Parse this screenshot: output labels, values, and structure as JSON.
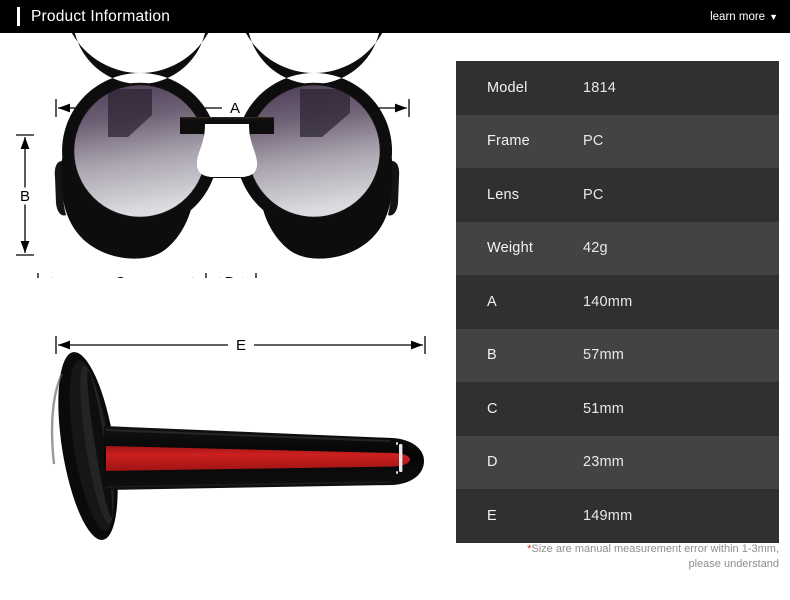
{
  "header": {
    "title": "Product Information",
    "learn_more_label": "learn more",
    "caret_icon": "chevron-down-icon",
    "background_color": "#000000",
    "accent_color": "#ffffff"
  },
  "diagram": {
    "front_view": {
      "name": "sunglasses-front-view",
      "dimension_labels": [
        "A",
        "B",
        "C",
        "D"
      ]
    },
    "side_view": {
      "name": "sunglasses-side-view",
      "dimension_labels": [
        "E"
      ]
    },
    "colors": {
      "frame": "#0d0d0d",
      "temple_stripe_red": "#c81e1e",
      "lens_top": "#4a3a52",
      "lens_bottom": "#d8d8dc",
      "dimension_line": "#000000"
    }
  },
  "spec_table": {
    "row_color_odd": "#303030",
    "row_color_even": "#434343",
    "rows": [
      {
        "label": "Model",
        "value": "1814"
      },
      {
        "label": "Frame",
        "value": "PC"
      },
      {
        "label": "Lens",
        "value": "PC"
      },
      {
        "label": "Weight",
        "value": "42g"
      },
      {
        "label": "A",
        "value": "140mm"
      },
      {
        "label": "B",
        "value": "57mm"
      },
      {
        "label": "C",
        "value": "51mm"
      },
      {
        "label": "D",
        "value": "23mm"
      },
      {
        "label": "E",
        "value": "149mm"
      }
    ]
  },
  "footnote": {
    "asterisk": "*",
    "line1": "Size are manual measurement error within 1-3mm,",
    "line2": "please understand",
    "asterisk_color": "#d93025"
  }
}
